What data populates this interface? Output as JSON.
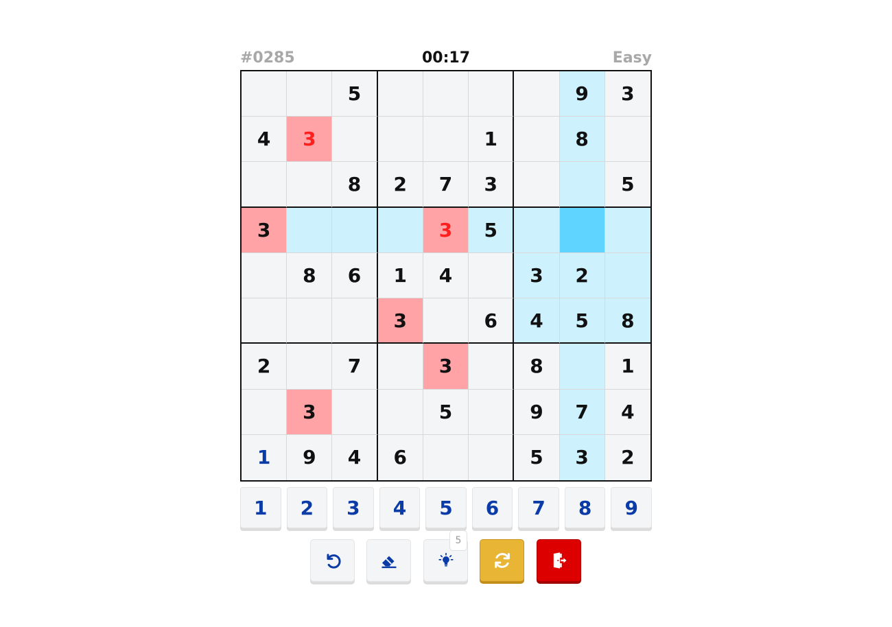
{
  "header": {
    "puzzle_id": "#0285",
    "timer": "00:17",
    "difficulty": "Easy"
  },
  "board": {
    "cells": [
      [
        "",
        "",
        "5",
        "",
        "",
        "",
        "",
        "9",
        "3"
      ],
      [
        "4",
        "3",
        "",
        "",
        "",
        "1",
        "",
        "8",
        ""
      ],
      [
        "",
        "",
        "8",
        "2",
        "7",
        "3",
        "",
        "",
        "5"
      ],
      [
        "3",
        "",
        "",
        "",
        "3",
        "5",
        "",
        "",
        ""
      ],
      [
        "",
        "8",
        "6",
        "1",
        "4",
        "",
        "3",
        "2",
        ""
      ],
      [
        "",
        "",
        "",
        "3",
        "",
        "6",
        "4",
        "5",
        "8"
      ],
      [
        "2",
        "",
        "7",
        "",
        "3",
        "",
        "8",
        "",
        "1"
      ],
      [
        "",
        "3",
        "",
        "",
        "5",
        "",
        "9",
        "7",
        "4"
      ],
      [
        "1",
        "9",
        "4",
        "6",
        "",
        "",
        "5",
        "3",
        "2"
      ]
    ],
    "selected": [
      3,
      7
    ],
    "conflict_cells": [
      [
        1,
        1
      ],
      [
        3,
        0
      ],
      [
        3,
        4
      ],
      [
        5,
        3
      ],
      [
        6,
        4
      ],
      [
        7,
        1
      ]
    ],
    "error_cells": [
      [
        1,
        1
      ],
      [
        3,
        4
      ]
    ],
    "user_cells": [
      [
        8,
        0
      ]
    ],
    "colors": {
      "highlight": "#cdf2fe",
      "selected": "#5fd4ff",
      "conflict": "#ffa3a6",
      "error_text": "#ff1f1f",
      "user_text": "#0a3ba6"
    }
  },
  "numpad": [
    "1",
    "2",
    "3",
    "4",
    "5",
    "6",
    "7",
    "8",
    "9"
  ],
  "actions": {
    "undo_icon": "undo-icon",
    "erase_icon": "eraser-icon",
    "hint_icon": "lightbulb-icon",
    "hint_count": "5",
    "new_game_icon": "refresh-icon",
    "exit_icon": "exit-door-icon"
  }
}
